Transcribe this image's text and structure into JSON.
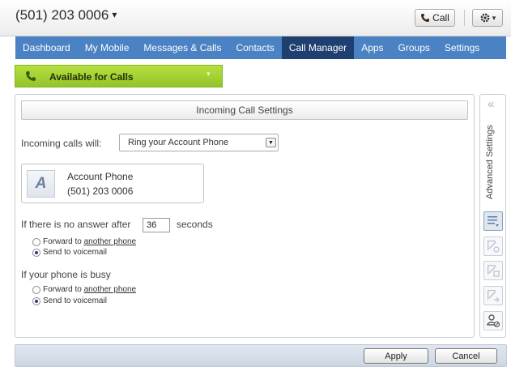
{
  "header": {
    "phone_number": "(501) 203 0006",
    "phone_caret": "▾",
    "call_label": "Call",
    "settings_icon": "gear-icon"
  },
  "nav": {
    "items": [
      {
        "label": "Dashboard",
        "active": false
      },
      {
        "label": "My Mobile",
        "active": false
      },
      {
        "label": "Messages & Calls",
        "active": false
      },
      {
        "label": "Contacts",
        "active": false
      },
      {
        "label": "Call Manager",
        "active": true
      },
      {
        "label": "Apps",
        "active": false
      },
      {
        "label": "Groups",
        "active": false
      },
      {
        "label": "Settings",
        "active": false
      }
    ],
    "bar_color": "#4a82c4",
    "active_color": "#1f3f70"
  },
  "status": {
    "label": "Available for Calls",
    "caret": "▾",
    "color": "#9ccb30"
  },
  "panel": {
    "title": "Incoming Call Settings",
    "incoming_label": "Incoming calls will:",
    "incoming_select_value": "Ring your Account Phone",
    "account_card": {
      "avatar_letter": "A",
      "name": "Account Phone",
      "number": "(501) 203 0006"
    },
    "no_answer": {
      "prefix": "If there is no answer after",
      "seconds_value": "36",
      "suffix": "seconds",
      "options": [
        {
          "prefix": "Forward to ",
          "link": "another phone",
          "checked": false
        },
        {
          "prefix": "Send to voicemail",
          "link": "",
          "checked": true
        }
      ]
    },
    "busy": {
      "label": "If your phone is busy",
      "options": [
        {
          "prefix": "Forward to ",
          "link": "another phone",
          "checked": false
        },
        {
          "prefix": "Send to voicemail",
          "link": "",
          "checked": true
        }
      ]
    }
  },
  "sidebar": {
    "collapse_glyph": "«",
    "title": "Advanced Settings",
    "tools": [
      {
        "icon": "list-settings-icon",
        "active": true
      },
      {
        "icon": "edit-blocked-icon",
        "active": false
      },
      {
        "icon": "edit-schedule-icon",
        "active": false
      },
      {
        "icon": "edit-forward-icon",
        "active": false
      },
      {
        "icon": "caller-blocked-icon",
        "active": false
      }
    ]
  },
  "footer": {
    "apply_label": "Apply",
    "cancel_label": "Cancel"
  }
}
